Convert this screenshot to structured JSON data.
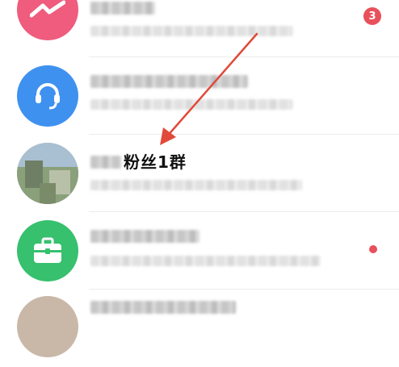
{
  "conversations": [
    {
      "avatar_icon": "messenger-bolt-icon",
      "avatar_color": "#ef5c7d",
      "unread_count": "3"
    },
    {
      "avatar_icon": "headset-icon",
      "avatar_color": "#3f91f0"
    },
    {
      "avatar_icon": "group-photo",
      "group_name": "粉丝1群"
    },
    {
      "avatar_icon": "briefcase-icon",
      "avatar_color": "#37c06e",
      "unread_dot": true
    }
  ],
  "annotation": {
    "type": "arrow",
    "color": "#e04a3a",
    "target": "group-name"
  }
}
